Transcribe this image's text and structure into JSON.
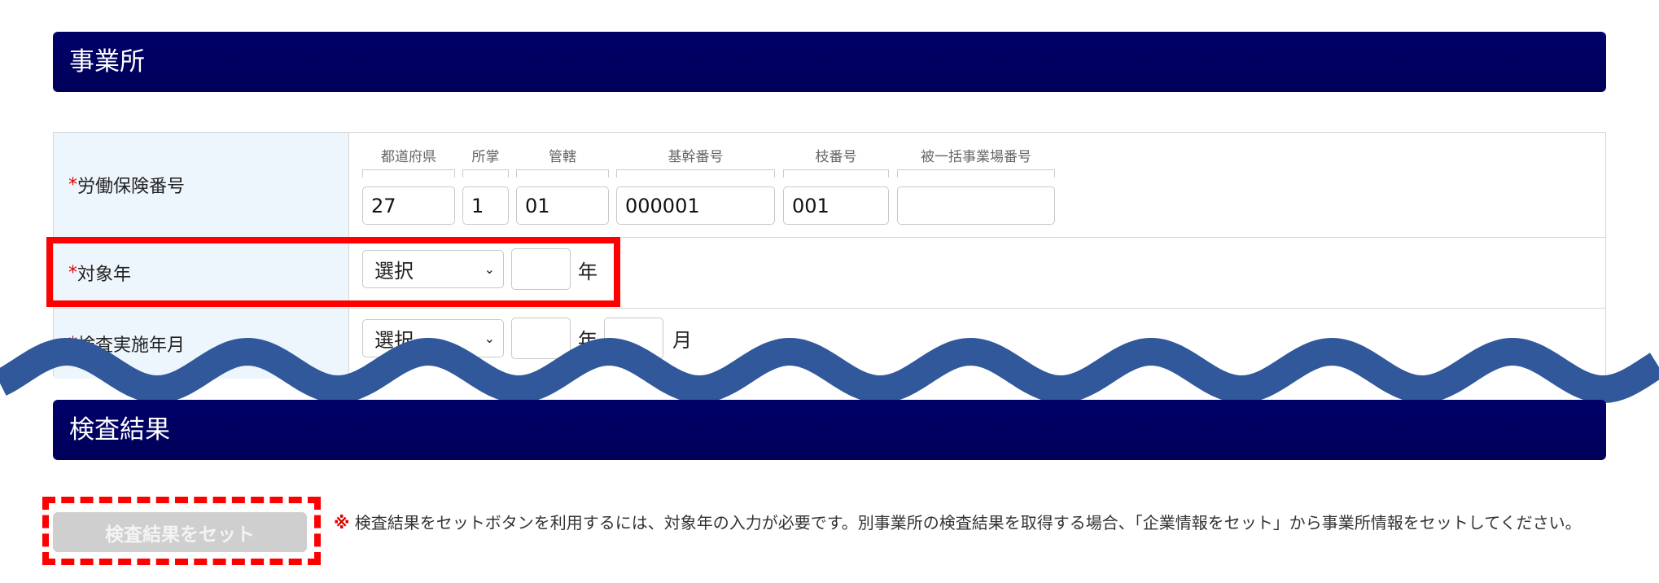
{
  "section1": {
    "title": "事業所"
  },
  "rows": [
    {
      "required": "*",
      "label": "労働保険番号"
    },
    {
      "required": "*",
      "label": "対象年"
    },
    {
      "required": "*",
      "label": "検査実施年月"
    }
  ],
  "insurance": {
    "sublabels": [
      "都道府県",
      "所掌",
      "管轄",
      "基幹番号",
      "枝番号",
      "被一括事業場番号"
    ],
    "values": [
      "27",
      "1",
      "01",
      "000001",
      "001",
      ""
    ]
  },
  "target_year": {
    "select": "選択",
    "year": "",
    "unit": "年"
  },
  "inspection": {
    "select": "選択",
    "year": "",
    "year_unit": "年",
    "month": "",
    "month_unit": "月"
  },
  "section2": {
    "title": "検査結果"
  },
  "set_button": "検査結果をセット",
  "note": {
    "mark": "※",
    "text": " 検査結果をセットボタンを利用するには、対象年の入力が必要です。別事業所の検査結果を取得する場合、「企業情報をセット」から事業所情報をセットしてください。"
  },
  "colors": {
    "header": "#000066",
    "required": "#e00000",
    "wave": "#30589a",
    "highlight": "#ff0000"
  }
}
